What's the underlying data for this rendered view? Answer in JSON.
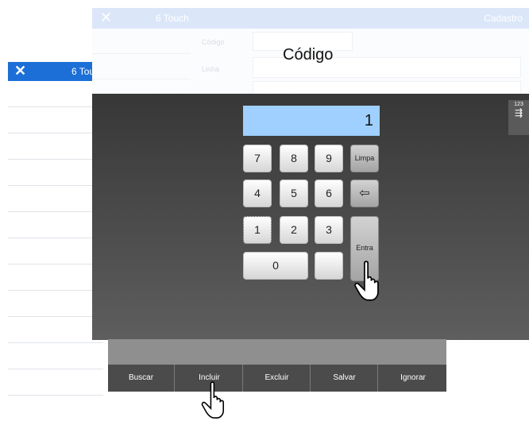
{
  "back_window": {
    "close_glyph": "✕",
    "title": "6 Tou",
    "row_count": 13
  },
  "cadastro": {
    "close_glyph": "✕",
    "title": "6 Touch",
    "right_title": "Cadastro",
    "codigo_label": "Código",
    "linha_label": "Linha",
    "heading": "Código"
  },
  "keypad": {
    "display_value": "1",
    "keys": {
      "k7": "7",
      "k8": "8",
      "k9": "9",
      "k4": "4",
      "k5": "5",
      "k6": "6",
      "k1": "1",
      "k2": "2",
      "k3": "3",
      "k0": "0",
      "blank": ""
    },
    "limpa": "Limpa",
    "back_icon": "⇦",
    "entra": "Entra",
    "side": {
      "label": "123",
      "icon": "keyboard-icon"
    }
  },
  "toolbar": {
    "buscar": "Buscar",
    "incluir": "Incluir",
    "excluir": "Excluir",
    "salvar": "Salvar",
    "ignorar": "Ignorar"
  },
  "colors": {
    "accent": "#1c6fd6",
    "display": "#9fd0ff",
    "toolbar": "#4b4b4b"
  }
}
